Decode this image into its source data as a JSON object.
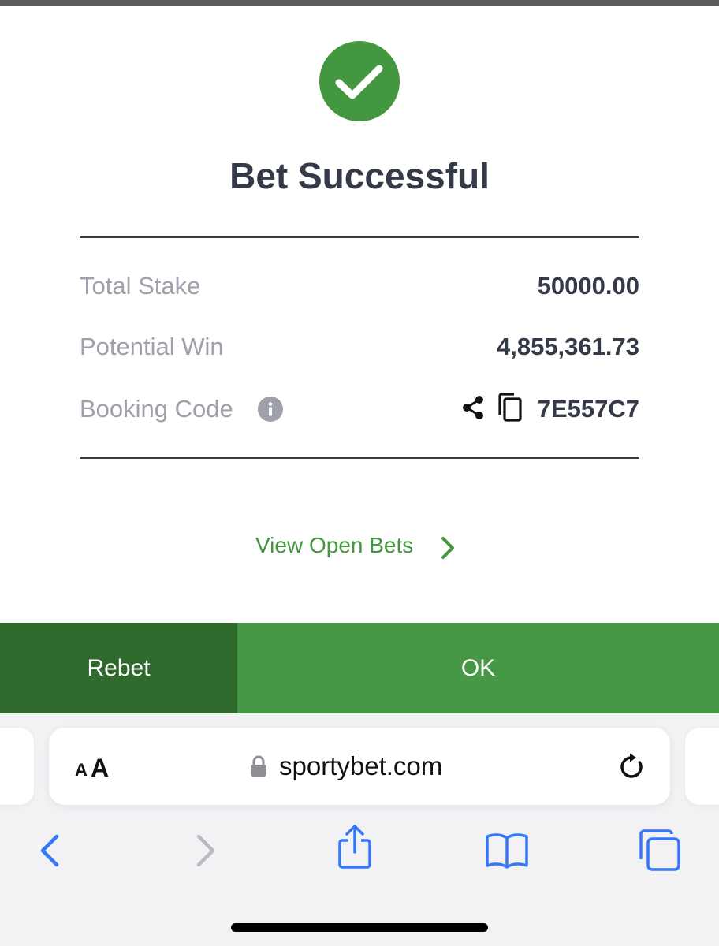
{
  "dialog": {
    "title": "Bet Successful",
    "total_stake_label": "Total Stake",
    "total_stake_value": "50000.00",
    "potential_win_label": "Potential Win",
    "potential_win_value": "4,855,361.73",
    "booking_code_label": "Booking Code",
    "booking_code_value": "7E557C7",
    "view_open_bets_label": "View Open Bets",
    "rebet_label": "Rebet",
    "ok_label": "OK"
  },
  "browser": {
    "text_size_small": "A",
    "text_size_big": "A",
    "url": "sportybet.com"
  },
  "icons": {
    "success": "check-circle-icon",
    "info": "info-icon",
    "share": "share-icon",
    "copy": "copy-icon",
    "chevron": "chevron-right-icon",
    "lock": "lock-icon",
    "reload": "reload-icon",
    "back": "back-icon",
    "forward": "forward-icon",
    "share_sheet": "share-sheet-icon",
    "bookmarks": "bookmarks-icon",
    "tabs": "tabs-icon"
  },
  "colors": {
    "brand_green": "#43973f",
    "rebet_green": "#2f6a2c",
    "ok_green": "#469846",
    "text_dark": "#353a48",
    "text_muted": "#9ea0ab",
    "safari_blue": "#3478f6"
  }
}
